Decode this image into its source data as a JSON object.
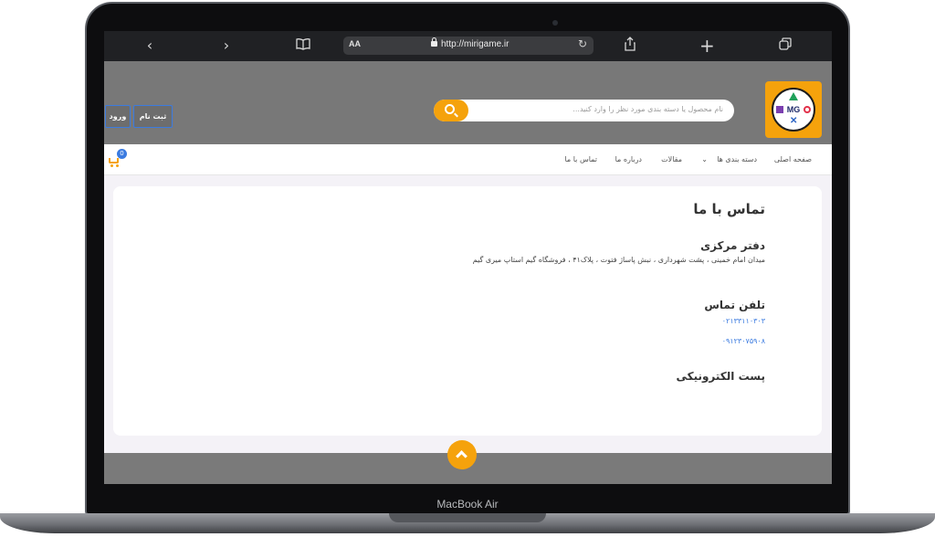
{
  "device": {
    "label": "MacBook Air"
  },
  "browser": {
    "aa_label": "AA",
    "url": "http://mirigame.ir",
    "back_icon": "‹",
    "forward_icon": "›",
    "book_icon": "bookmarks-icon",
    "share_icon": "share-icon",
    "new_tab_icon": "+",
    "tabs_icon": "tabs-icon",
    "reload_icon": "↻"
  },
  "header": {
    "logo_text": "MG",
    "search_placeholder": "نام محصول یا دسته بندی مورد نظر را وارد کنید...",
    "register_label": "ثبت نام",
    "login_label": "ورود"
  },
  "nav": {
    "items": [
      "صفحه اصلی",
      "دسته بندی ها",
      "مقالات",
      "درباره ما",
      "تماس با ما"
    ],
    "cart_count": "0"
  },
  "page": {
    "title": "تماس با ما",
    "office_heading": "دفتر مرکزی",
    "address": "میدان امام خمینی ، پشت شهرداری ، نبش پاساژ فتوت ، پلاک۴۱ ، فروشگاه گیم استاپ میری گیم",
    "phone_heading": "تلفن تماس",
    "phone_1": "۰۲۱۳۳۱۱۰۳۰۳",
    "phone_2": "۰۹۱۲۳۰۷۵۹۰۸",
    "email_heading": "پست الکترونیکی"
  },
  "colors": {
    "accent": "#f5a20c",
    "link": "#3b7be0",
    "header_bg": "#787878"
  }
}
